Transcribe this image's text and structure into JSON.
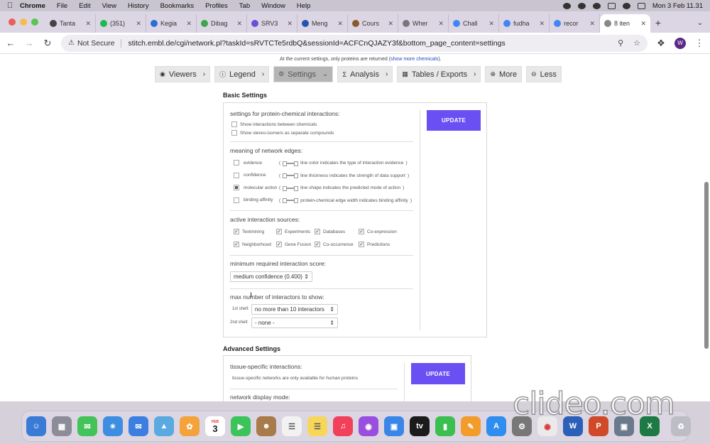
{
  "menubar": {
    "app": "Chrome",
    "items": [
      "File",
      "Edit",
      "View",
      "History",
      "Bookmarks",
      "Profiles",
      "Tab",
      "Window",
      "Help"
    ],
    "datetime": "Mon 3 Feb  11.31"
  },
  "tabs": [
    {
      "label": "Tanta",
      "color": "#444"
    },
    {
      "label": "(351)",
      "color": "#1fb954"
    },
    {
      "label": "Kegia",
      "color": "#2b6fd6"
    },
    {
      "label": "Dibag",
      "color": "#3ea64a"
    },
    {
      "label": "SRV3",
      "color": "#6b4fd8"
    },
    {
      "label": "Meng",
      "color": "#2554b0"
    },
    {
      "label": "Cours",
      "color": "#8a5a2b"
    },
    {
      "label": "Wher",
      "color": "#777"
    },
    {
      "label": "Chall",
      "color": "#4285f4"
    },
    {
      "label": "fudha",
      "color": "#4285f4"
    },
    {
      "label": "recor",
      "color": "#4285f4"
    },
    {
      "label": "8 iten",
      "color": "#888",
      "active": true
    }
  ],
  "address": {
    "security_label": "Not Secure",
    "url": "stitch.embl.de/cgi/network.pl?taskId=sRVTCTe5rdbQ&sessionId=ACFCnQJAZY3f&bottom_page_content=settings",
    "profile_initial": "W"
  },
  "page": {
    "notice_text": "At the current settings, only proteins are returned (",
    "notice_link": "show more chemicals",
    "notice_end": ").",
    "nav": [
      {
        "icon": "◉",
        "label": "Viewers",
        "caret": "›",
        "active": false
      },
      {
        "icon": "ⓘ",
        "label": "Legend",
        "caret": "›",
        "active": false
      },
      {
        "icon": "⚙",
        "label": "Settings",
        "caret": "⌄",
        "active": true
      },
      {
        "icon": "Σ",
        "label": "Analysis",
        "caret": "›",
        "active": false
      },
      {
        "icon": "▦",
        "label": "Tables / Exports",
        "caret": "›",
        "active": false
      },
      {
        "icon": "⊕",
        "label": "More",
        "caret": "",
        "active": false
      },
      {
        "icon": "⊖",
        "label": "Less",
        "caret": "",
        "active": false
      }
    ],
    "basic": {
      "title": "Basic Settings",
      "update_label": "UPDATE",
      "pc_title": "settings for protein-chemical interactions:",
      "pc_options": [
        "Show interactions between chemicals",
        "Show stereo-isomers as separate compounds"
      ],
      "edges_title": "meaning of network edges:",
      "edges": [
        {
          "label": "evidence",
          "desc": "line color indicates the type of interaction evidence",
          "checked": false
        },
        {
          "label": "confidence",
          "desc": "line thickness indicates the strength of data support",
          "checked": false
        },
        {
          "label": "molecular action",
          "desc": "line shape indicates the predicted mode of action",
          "checked": true
        },
        {
          "label": "binding affinity",
          "desc": "protein-chemical edge width indicates binding affinity",
          "checked": false
        }
      ],
      "sources_title": "active interaction sources:",
      "sources_row1": [
        "Textmining",
        "Experiments",
        "Databases",
        "Co-expression"
      ],
      "sources_row2": [
        "Neighborhood",
        "Gene Fusion",
        "Co-occurrence",
        "Predictions"
      ],
      "score_title": "minimum required interaction score:",
      "score_value": "medium confidence (0.400)",
      "max_title": "max number of interactors to show:",
      "shell1_label": "1st shell:",
      "shell1_value": "no more than 10 interactors",
      "shell2_label": "2nd shell:",
      "shell2_value": "- none -"
    },
    "advanced": {
      "title": "Advanced Settings",
      "update_label": "UPDATE",
      "tissue_title": "tissue-specific interactions:",
      "tissue_note": "tissue-specific networks are only available for human proteins",
      "display_title": "network display mode:"
    }
  },
  "dock": {
    "calendar_month": "FEB",
    "calendar_day": "3"
  },
  "watermark": "clideo.com"
}
